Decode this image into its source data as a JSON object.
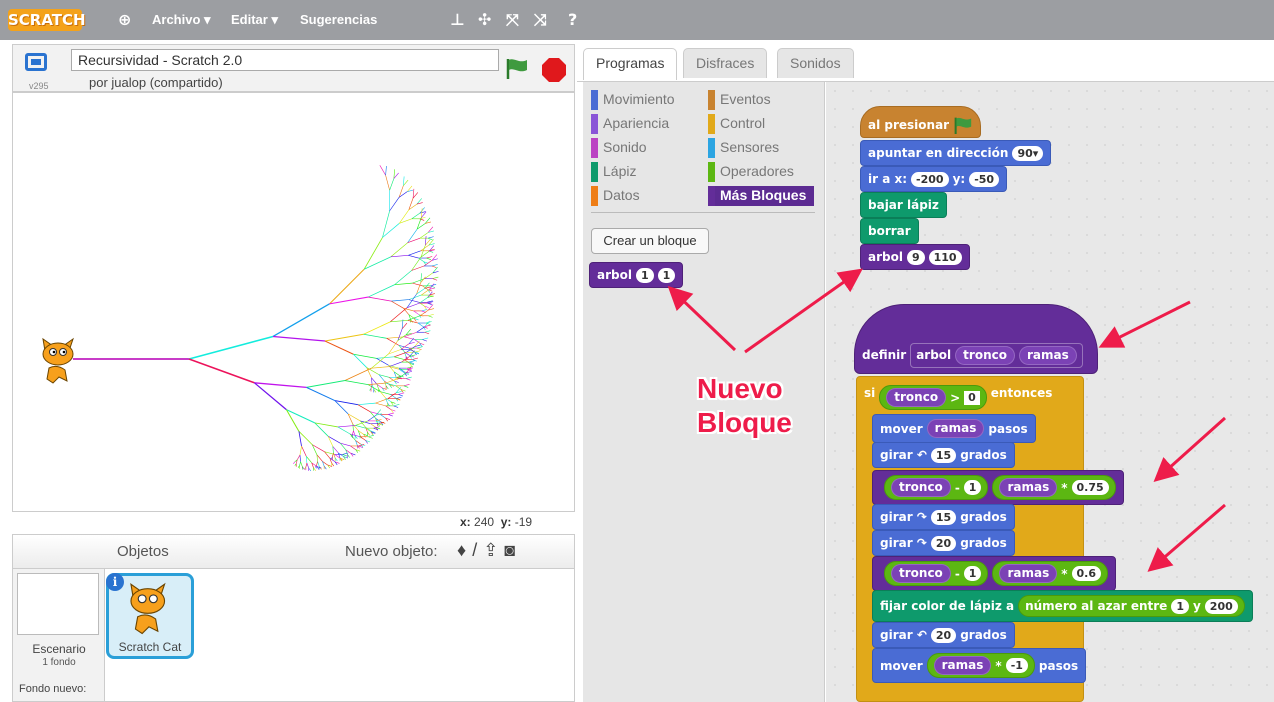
{
  "menubar": {
    "logo": "SCRATCH",
    "items": [
      "Archivo ▾",
      "Editar ▾",
      "Sugerencias"
    ],
    "icons": [
      "globe-icon",
      "stamp-icon",
      "scissors-icon",
      "grow-icon",
      "shrink-icon",
      "help-icon"
    ]
  },
  "project": {
    "title": "Recursividad - Scratch 2.0",
    "author": "por jualop (compartido)",
    "version": "v295"
  },
  "stage": {
    "x_label": "x:",
    "x": "240",
    "y_label": "y:",
    "y": "-19"
  },
  "sprites": {
    "title": "Objetos",
    "new_label": "Nuevo objeto:",
    "stage_name": "Escenario",
    "stage_bg": "1 fondo",
    "new_bg": "Fondo nuevo:",
    "sprite_name": "Scratch Cat"
  },
  "tabs": [
    "Programas",
    "Disfraces",
    "Sonidos"
  ],
  "categories": {
    "left": [
      {
        "label": "Movimiento",
        "color": "#4a6cd4"
      },
      {
        "label": "Apariencia",
        "color": "#8a55d7"
      },
      {
        "label": "Sonido",
        "color": "#bb42c3"
      },
      {
        "label": "Lápiz",
        "color": "#0e9a6c"
      },
      {
        "label": "Datos",
        "color": "#ee7d16"
      }
    ],
    "right": [
      {
        "label": "Eventos",
        "color": "#c88330"
      },
      {
        "label": "Control",
        "color": "#e1a91a"
      },
      {
        "label": "Sensores",
        "color": "#2ca5e2"
      },
      {
        "label": "Operadores",
        "color": "#5cb712"
      },
      {
        "label": "Más Bloques",
        "color": "#632d99"
      }
    ]
  },
  "palette": {
    "make_block": "Crear un bloque",
    "block": "arbol",
    "a1": "1",
    "a2": "1"
  },
  "script1": {
    "hat": "al presionar",
    "dir": "apuntar en dirección",
    "dir_v": "90▾",
    "goto": "ir a x:",
    "gx": "-200",
    "gy_l": "y:",
    "gy": "-50",
    "pendown": "bajar lápiz",
    "clear": "borrar",
    "call": "arbol",
    "c1": "9",
    "c2": "110"
  },
  "script2": {
    "define": "definir",
    "name": "arbol",
    "p1": "tronco",
    "p2": "ramas",
    "if": "si",
    "gt": ">",
    "zero": "0",
    "then": "entonces",
    "move": "mover",
    "steps": "pasos",
    "turnl": "girar ↶",
    "turnr": "girar ↷",
    "deg": "grados",
    "n15": "15",
    "n20": "20",
    "minus": "-",
    "one": "1",
    "times": "*",
    "k1": "0.75",
    "k2": "0.6",
    "setcolor": "fijar color de lápiz a",
    "random": "número al azar entre",
    "r1": "1",
    "and": "y",
    "r2": "200",
    "neg1": "-1"
  },
  "callout": {
    "line1": "Nuevo",
    "line2": "Bloque"
  }
}
